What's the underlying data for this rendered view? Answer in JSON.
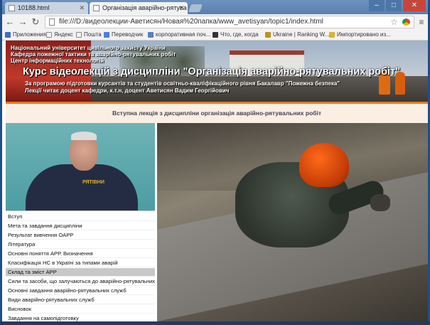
{
  "browser": {
    "tabs": [
      {
        "label": "10188.html"
      },
      {
        "label": "Організація аварійно-рятува"
      }
    ],
    "address": "file:///D:/видеолекции-Аветисян/Новая%20папка/www_avetisyan/topic1/index.html",
    "bookmarks": [
      {
        "label": "Приложения",
        "color": "#3a6fc4"
      },
      {
        "label": "Яндекс",
        "color": "#f2f2f2"
      },
      {
        "label": "Пошта",
        "color": "#f2f2f2"
      },
      {
        "label": "Переводчик",
        "color": "#4a7de0"
      },
      {
        "label": "корпоративная поч...",
        "color": "#5a7fc0"
      },
      {
        "label": "Что, где, когда",
        "color": "#333333"
      },
      {
        "label": "Ukraine | Ranking W...",
        "color": "#c09020"
      },
      {
        "label": "Импортировано из...",
        "color": "#e0b030"
      }
    ]
  },
  "banner": {
    "line1": "Національний університет цивільного захисту України",
    "line2": "Кафедра пожежної тактики та аварійно-рятувальних робіт",
    "line3": "Центр інформаційних технологій",
    "title": "Курс відеолекцій з дисципліни \"Організація аварійно-рятувальних робіт\"",
    "line4": "За програмою підготовки курсантів та студентів освітньо-кваліфікаційного рівня Бакалавр \"Пожежна безпека\"",
    "line5": "Лекції читає доцент кафедри, к.т.н, доцент Аветисян Вадим Георгійович"
  },
  "subtitle": "Вступна лекція з дисципліни організація аварійно-рятувальних робіт",
  "video": {
    "badge": "РЯТІВНИ"
  },
  "menu": {
    "selected_index": 6,
    "items": [
      "Вступ",
      "Мета та завдання дисципліни",
      "Результат вивчення ОАРР",
      "Література",
      "Основні поняття АРР. Визначення",
      "Класифікація НС в Україні за типами аварій",
      "Склад та зміст АРР",
      "Сили та засоби, що залучаються до аварійно-рятувальних ро",
      "Основні завдання аварійно-рятувальних служб",
      "Види аварійно-рятувальних служб",
      "Висновок",
      "Завдання на самопідготовку"
    ]
  }
}
